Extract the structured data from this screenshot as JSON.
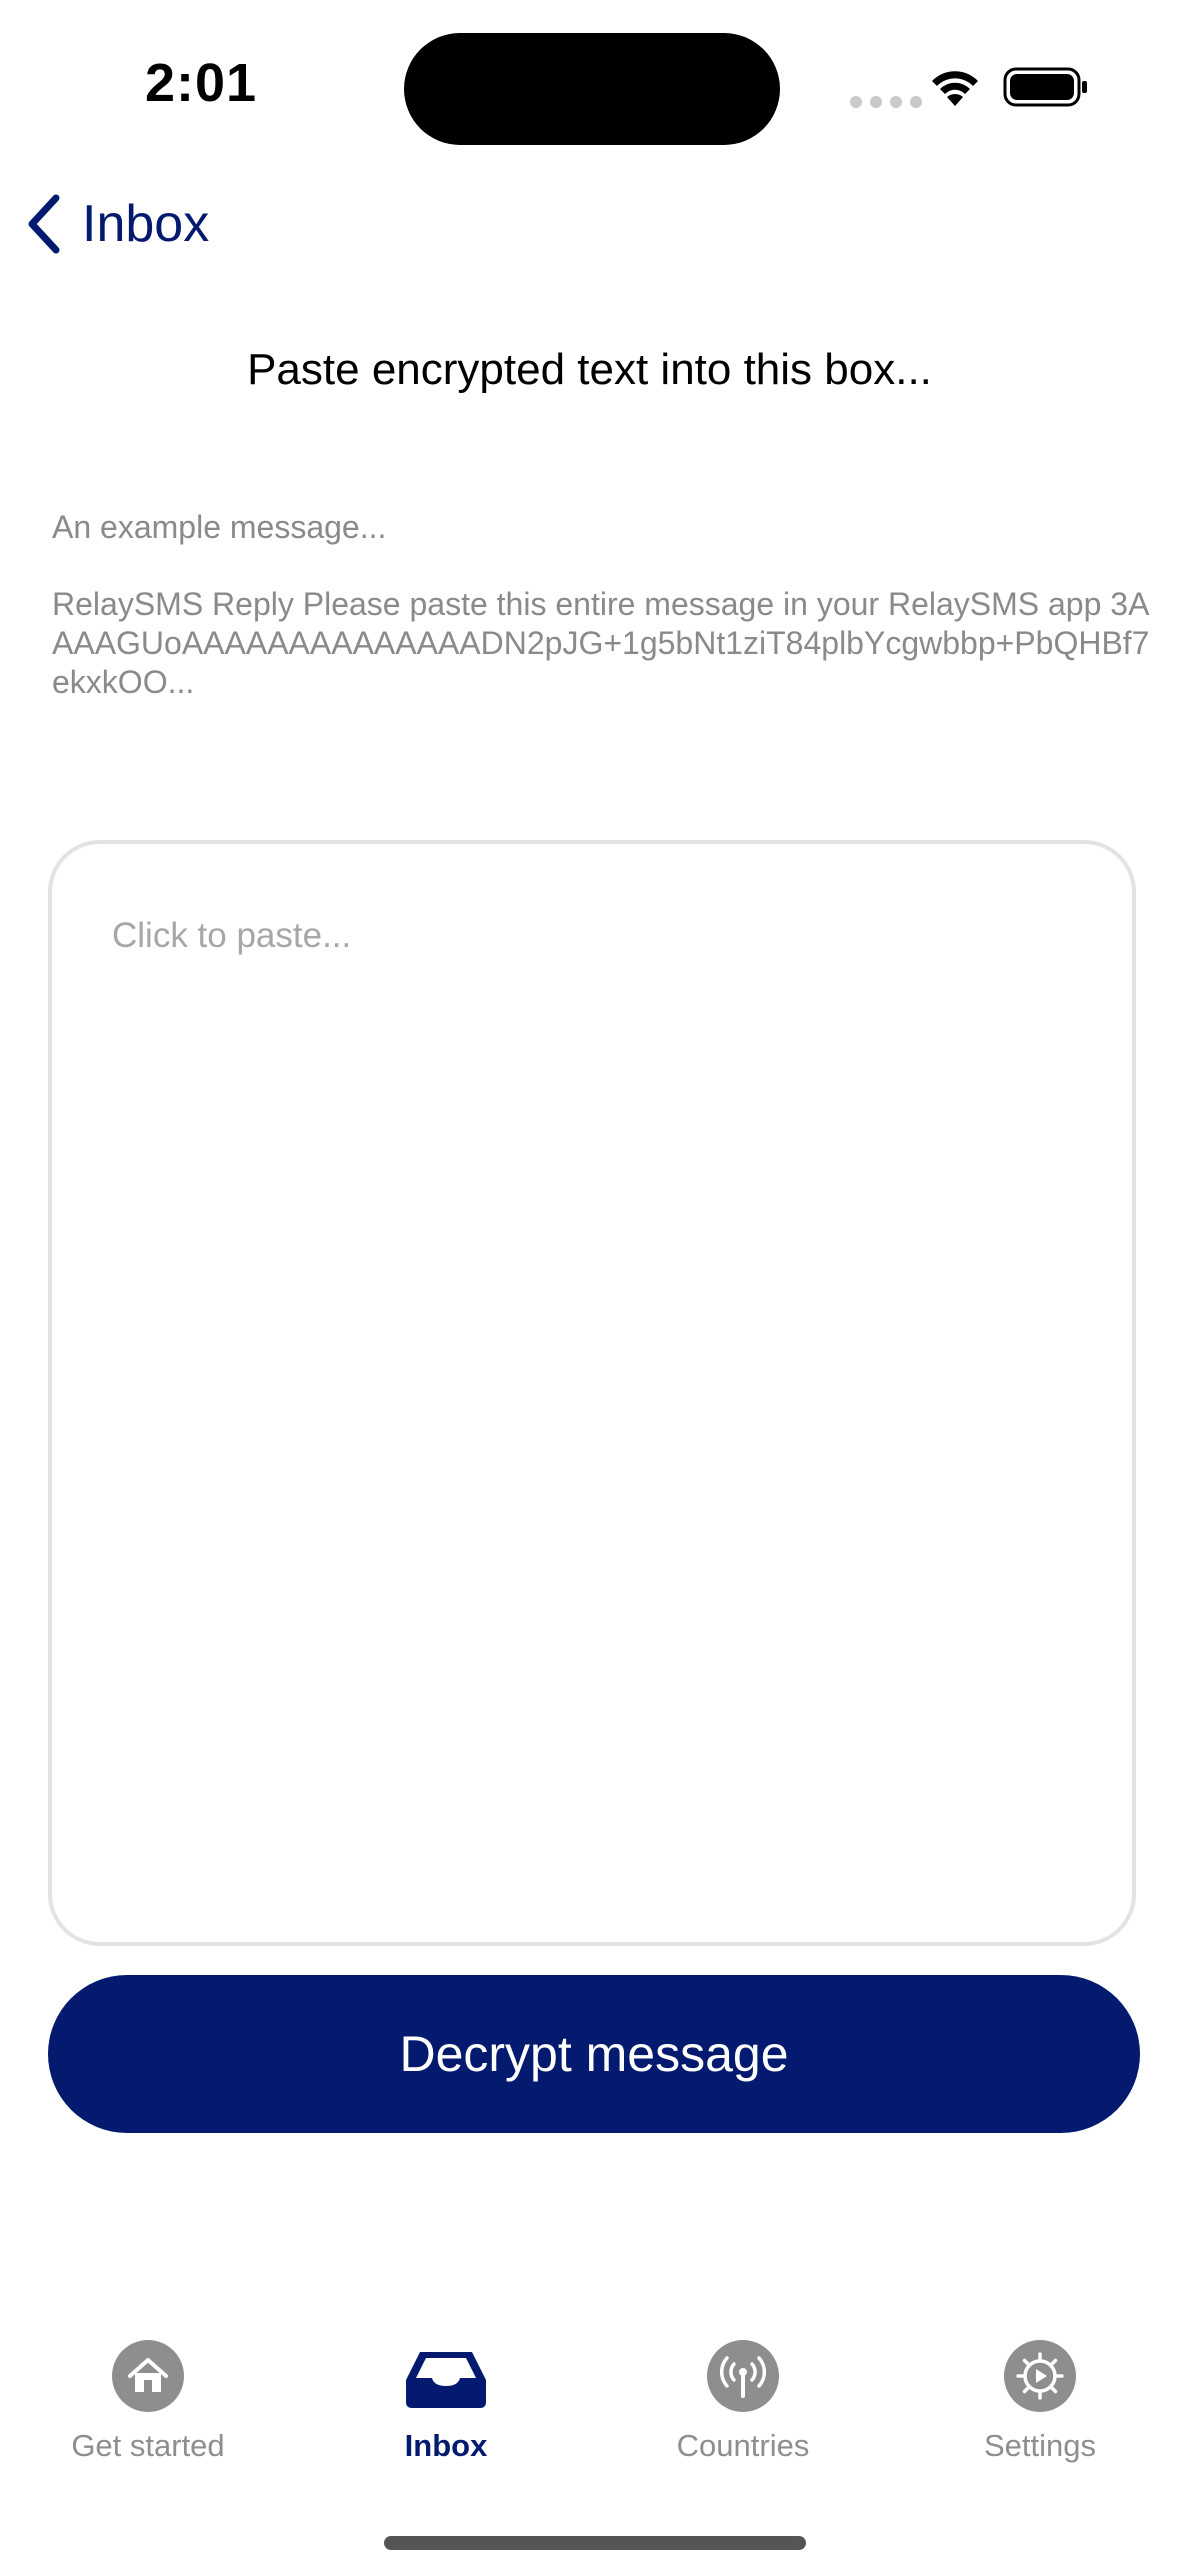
{
  "status_bar": {
    "time": "2:01"
  },
  "nav": {
    "back_label": "Inbox"
  },
  "heading": "Paste encrypted text into this box...",
  "example": {
    "title": "An example message...",
    "body": "RelaySMS Reply Please paste this entire message in your RelaySMS app 3AAAAGUoAAAAAAAAAAAAAADN2pJG+1g5bNt1ziT84plbYcgwbbp+PbQHBf7ekxkOO..."
  },
  "paste_box": {
    "placeholder": "Click to paste...",
    "value": ""
  },
  "decrypt_button": {
    "label": "Decrypt message"
  },
  "tabs": [
    {
      "label": "Get started",
      "icon": "home-icon",
      "active": false
    },
    {
      "label": "Inbox",
      "icon": "inbox-icon",
      "active": true
    },
    {
      "label": "Countries",
      "icon": "broadcast-icon",
      "active": false
    },
    {
      "label": "Settings",
      "icon": "gear-icon",
      "active": false
    }
  ],
  "colors": {
    "accent": "#031a6e",
    "inactive": "#8e8e8e",
    "text_secondary": "#8a8a8a",
    "border": "#e3e3e3"
  }
}
